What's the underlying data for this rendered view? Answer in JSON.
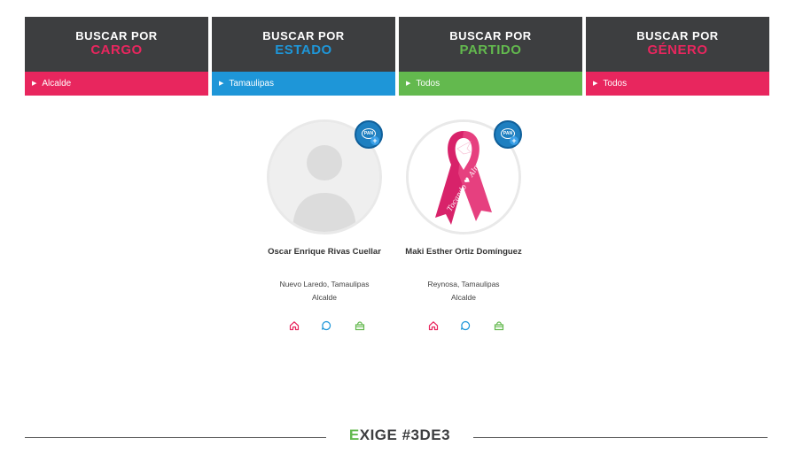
{
  "filters": [
    {
      "line1": "BUSCAR POR",
      "line2": "CARGO",
      "value": "Alcalde",
      "accent": "#e8265e",
      "bar_color": "#e8265e"
    },
    {
      "line1": "BUSCAR POR",
      "line2": "ESTADO",
      "value": "Tamaulipas",
      "accent": "#1e96d8",
      "bar_color": "#1e96d8"
    },
    {
      "line1": "BUSCAR POR",
      "line2": "PARTIDO",
      "value": "Todos",
      "accent": "#63b94e",
      "bar_color": "#63b94e"
    },
    {
      "line1": "BUSCAR POR",
      "line2": "GÉNERO",
      "value": "Todos",
      "accent": "#e8265e",
      "bar_color": "#e8265e"
    }
  ],
  "candidates": [
    {
      "name": "Oscar Enrique Rivas Cuellar",
      "location": "Nuevo Laredo, Tamaulipas",
      "role": "Alcalde",
      "party_badge": "PAN",
      "photo": "default-avatar-icon"
    },
    {
      "name": "Maki Esther Ortiz Domínguez",
      "location": "Reynosa, Tamaulipas",
      "role": "Alcalde",
      "party_badge": "PAN",
      "photo": "pink-ribbon-image",
      "photo_text": "Tocando ♥ Almas"
    }
  ],
  "action_icons": [
    {
      "name": "home-icon",
      "color": "#e8265e"
    },
    {
      "name": "chat-icon",
      "color": "#1e96d8"
    },
    {
      "name": "bag-icon",
      "color": "#63b94e"
    }
  ],
  "footer": {
    "first_letter": "E",
    "rest": "XIGE #3DE3"
  }
}
